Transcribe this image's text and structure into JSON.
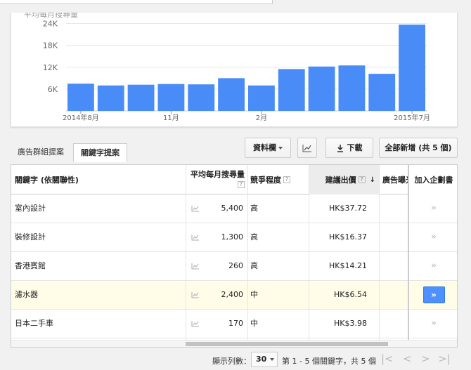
{
  "chart_data": {
    "type": "bar",
    "title": "平均每月搜尋量",
    "yticks": [
      6000,
      12000,
      18000,
      24000
    ],
    "ytick_labels": [
      "6K",
      "12K",
      "18K",
      "24K"
    ],
    "ylim": [
      0,
      27000
    ],
    "x_labels": [
      {
        "index": 0,
        "label": "2014年8月"
      },
      {
        "index": 3,
        "label": "11月"
      },
      {
        "index": 6,
        "label": "2月"
      },
      {
        "index": 11,
        "label": "2015年7月"
      }
    ],
    "values": [
      7500,
      7000,
      7200,
      7400,
      7300,
      9000,
      7000,
      11500,
      12200,
      12500,
      10200,
      23700
    ],
    "bar_color": "#4a8cf7",
    "grid": true
  },
  "tabs": {
    "adgroup": "廣告群組提案",
    "keyword": "關鍵字提案"
  },
  "toolbar": {
    "columns_label": "資料欄",
    "chart_icon": "line-chart-icon",
    "download_label": "下載",
    "download_icon": "download-icon",
    "add_all_label": "全部新增 (共 5 個)"
  },
  "table": {
    "headers": {
      "keyword": "關鍵字 (依關聯性)",
      "avg_searches": "平均每月搜尋量",
      "competition": "競爭程度",
      "suggested_bid": "建議出價",
      "ad_share": "廣告曝光",
      "add_to_plan": "加入企劃書"
    },
    "rows": [
      {
        "keyword": "室內設計",
        "avg": "5,400",
        "competition": "高",
        "bid": "HK$37.72"
      },
      {
        "keyword": "裝修設計",
        "avg": "1,300",
        "competition": "高",
        "bid": "HK$16.37"
      },
      {
        "keyword": "香港賓館",
        "avg": "260",
        "competition": "高",
        "bid": "HK$14.21"
      },
      {
        "keyword": "濾水器",
        "avg": "2,400",
        "competition": "中",
        "bid": "HK$6.54"
      },
      {
        "keyword": "日本二手車",
        "avg": "170",
        "competition": "中",
        "bid": "HK$3.98"
      }
    ],
    "add_glyph": "»",
    "qmark": "?"
  },
  "pager": {
    "rows_label": "顯示列數：",
    "rows_value": "30",
    "info": "第 1 - 5 個關鍵字，共 5 個",
    "first": "|<",
    "prev": "<",
    "next": ">",
    "last": ">|"
  }
}
